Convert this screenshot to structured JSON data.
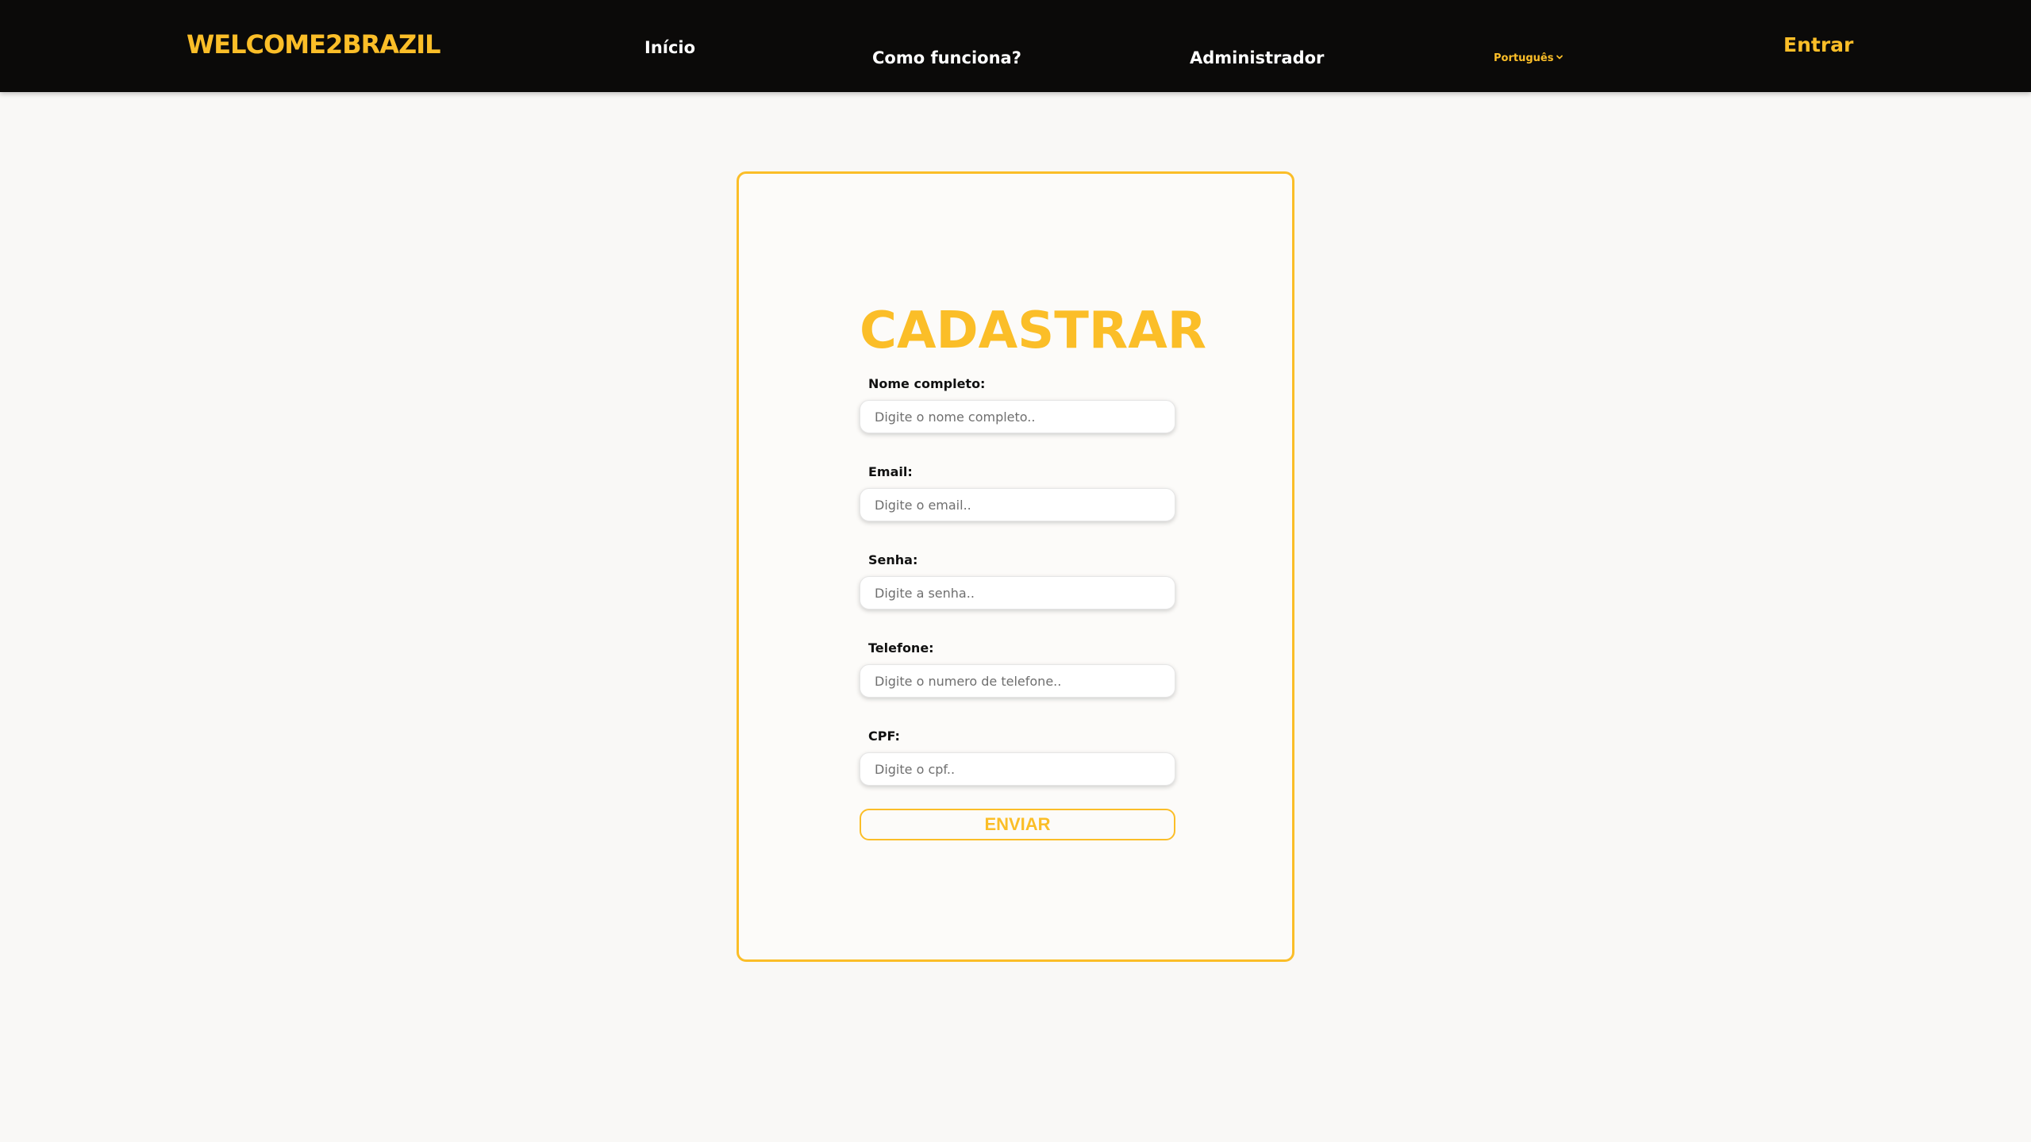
{
  "navbar": {
    "brand": "WELCOME2BRAZIL",
    "links": [
      "Início",
      "Como funciona?",
      "Administrador"
    ],
    "language": "Português",
    "login": "Entrar"
  },
  "form": {
    "title": "CADASTRAR",
    "fields": [
      {
        "label": "Nome completo:",
        "placeholder": "Digite o nome completo..",
        "value": ""
      },
      {
        "label": "Email:",
        "placeholder": "Digite o email..",
        "value": ""
      },
      {
        "label": "Senha:",
        "placeholder": "Digite a senha..",
        "value": ""
      },
      {
        "label": "Telefone:",
        "placeholder": "Digite o numero de telefone..",
        "value": ""
      },
      {
        "label": "CPF:",
        "placeholder": "Digite o cpf..",
        "value": ""
      }
    ],
    "submit": "ENVIAR"
  },
  "colors": {
    "accent": "#fbbe28",
    "navbar_bg": "#0b0a09",
    "page_bg": "#f9f8f6"
  },
  "icons": {
    "language_dropdown": "chevron-down-icon"
  }
}
